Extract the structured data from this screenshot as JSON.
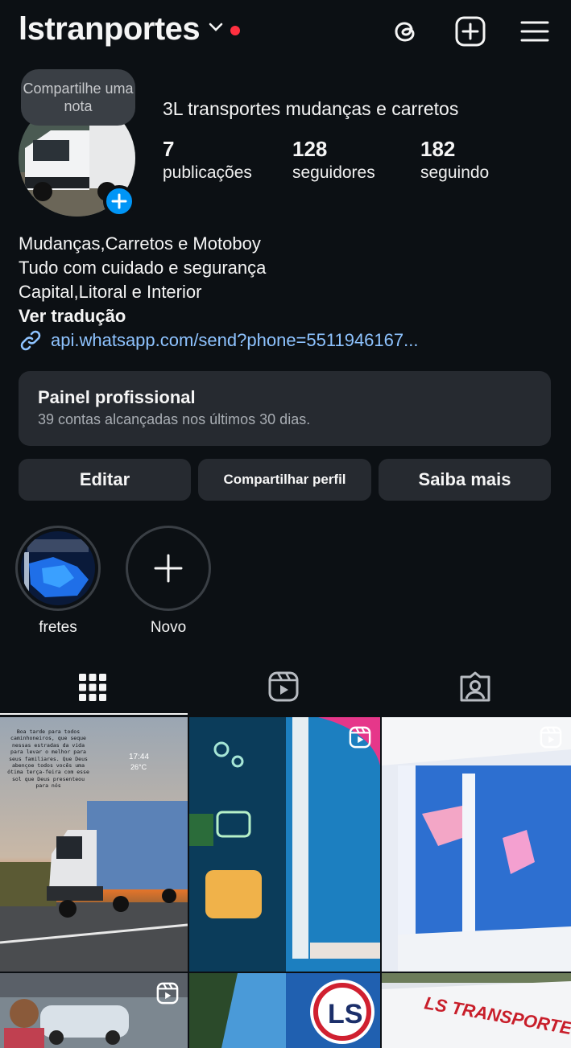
{
  "header": {
    "username": "lstranportes",
    "notification_color": "#ff3040"
  },
  "profile": {
    "note_placeholder": "Compartilhe uma nota",
    "full_name": "3L transportes mudanças e carretos",
    "stats": [
      {
        "value": "7",
        "label": "publicações"
      },
      {
        "value": "128",
        "label": "seguidores"
      },
      {
        "value": "182",
        "label": "seguindo"
      }
    ],
    "bio_lines": [
      "Mudanças,Carretos e Motoboy",
      "Tudo com cuidado e segurança",
      "Capital,Litoral e Interior"
    ],
    "translate_label": "Ver tradução",
    "link": "api.whatsapp.com/send?phone=5511946167..."
  },
  "panel": {
    "title": "Painel profissional",
    "subtitle": "39 contas alcançadas nos últimos 30 dias."
  },
  "buttons": {
    "edit": "Editar",
    "share": "Compartilhar perfil",
    "more": "Saiba mais"
  },
  "highlights": [
    {
      "name": "fretes"
    },
    {
      "name": "Novo"
    }
  ],
  "tabs": [
    "grid-icon",
    "reels-icon",
    "tagged-icon"
  ],
  "posts": {
    "post1_caption": "Boa tarde para todos caminhoneiros, que seque nessas estradas da vida para levar o melhor para seus familiares. Que Deus abençoe todos vocês uma ótima terça-feira com esse sol que Deus presenteou para nós",
    "post1_time": "17:44",
    "post1_temp": "26°C",
    "post8_brand": "LS TRANSPORTES"
  },
  "colors": {
    "background": "#0c1014",
    "surface": "#262a30",
    "accent": "#0095f6",
    "link": "#8ec3ff"
  }
}
